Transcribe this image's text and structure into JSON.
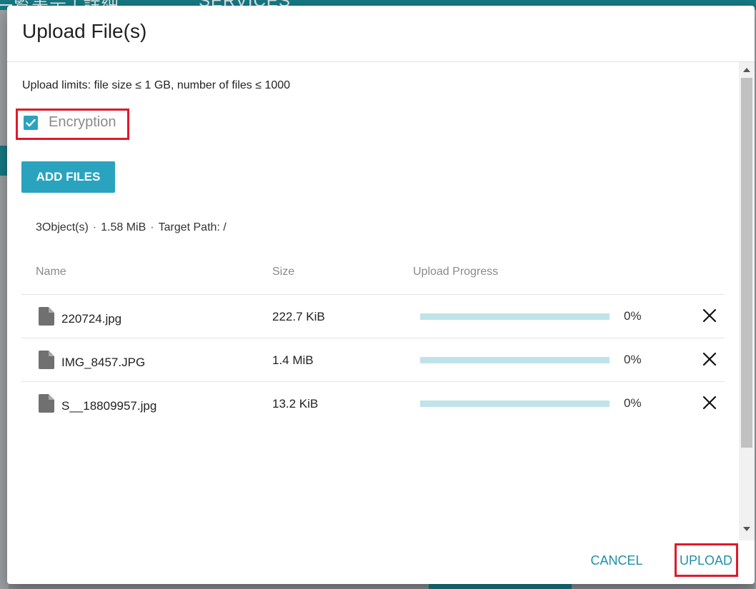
{
  "background": {
    "topbar_left_text": "一覧表示 | 詳細",
    "topbar_services_text": "SERVICES",
    "topbar_color": "#167a84"
  },
  "dialog": {
    "title": "Upload File(s)",
    "limits_text": "Upload limits: file size ≤ 1 GB, number of files ≤ 1000",
    "encryption": {
      "label": "Encryption",
      "checked": true
    },
    "add_files_label": "ADD FILES",
    "summary": {
      "objects": "3Object(s)",
      "size": "1.58 MiB",
      "target_path": "Target Path: /"
    },
    "table": {
      "headers": {
        "name": "Name",
        "size": "Size",
        "progress": "Upload Progress"
      },
      "rows": [
        {
          "name": "220724.jpg",
          "size": "222.7 KiB",
          "progress_label": "0%",
          "progress": 0
        },
        {
          "name": "IMG_8457.JPG",
          "size": "1.4 MiB",
          "progress_label": "0%",
          "progress": 0
        },
        {
          "name": "S__18809957.jpg",
          "size": "13.2 KiB",
          "progress_label": "0%",
          "progress": 0
        }
      ]
    },
    "footer": {
      "cancel_label": "CANCEL",
      "upload_label": "UPLOAD"
    }
  },
  "icons": {
    "checkbox": "check-icon",
    "file": "file-icon",
    "remove": "close-icon"
  },
  "colors": {
    "accent": "#2aa3bf",
    "progress_track": "#bfe3e9",
    "highlight": "#e0192a",
    "link": "#1f8fa8"
  }
}
